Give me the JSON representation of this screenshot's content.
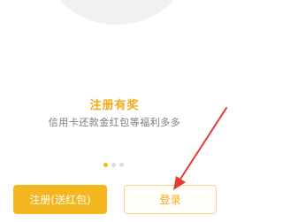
{
  "slide": {
    "title": "注册有奖",
    "subtitle": "信用卡还款金红包等福利多多",
    "total_pages": 3,
    "current_page": 1
  },
  "buttons": {
    "register_label": "注册(送红包)",
    "login_label": "登录"
  },
  "colors": {
    "accent": "#f4b61f",
    "title": "#f2a91c",
    "subtitle": "#7c7c7c",
    "annotation_arrow": "#e53935"
  }
}
